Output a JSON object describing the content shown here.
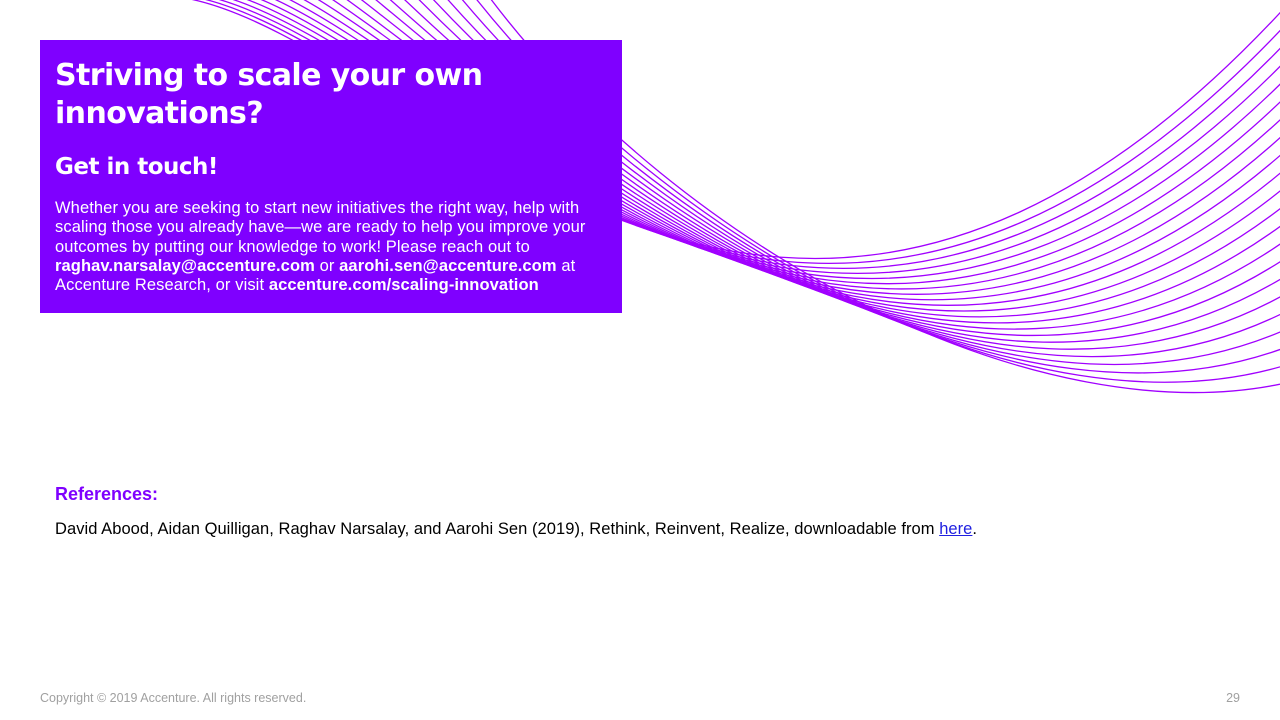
{
  "slide": {
    "title": "Striving to scale your own innovations?",
    "subtitle": "Get in touch!",
    "body": {
      "text_1": "Whether you are seeking to start new initiatives the right way, help with scaling those you already have—we are ready to help you improve your outcomes by putting our knowledge to work! Please reach out to ",
      "email_1": "raghav.narsalay@accenture.com",
      "text_2": " or ",
      "email_2": "aarohi.sen@accenture.com",
      "text_3": " at Accenture Research, or visit ",
      "website": "accenture.com/scaling-innovation"
    },
    "references": {
      "heading": "References:",
      "entry_text": "David Abood, Aidan Quilligan, Raghav Narsalay, and Aarohi Sen (2019), Rethink, Reinvent, Realize, downloadable from ",
      "link_label": "here",
      "entry_end": "."
    },
    "footer": {
      "copyright": "Copyright © 2019 Accenture. All rights reserved.",
      "page_number": "29"
    }
  },
  "colors": {
    "accent_purple": "#7f00ff",
    "wave_purple": "#a100ff",
    "link_blue": "#1f1fe0",
    "footer_gray": "#a0a0a0"
  },
  "icons": {
    "decoration": "purple-wave-lines-graphic"
  }
}
